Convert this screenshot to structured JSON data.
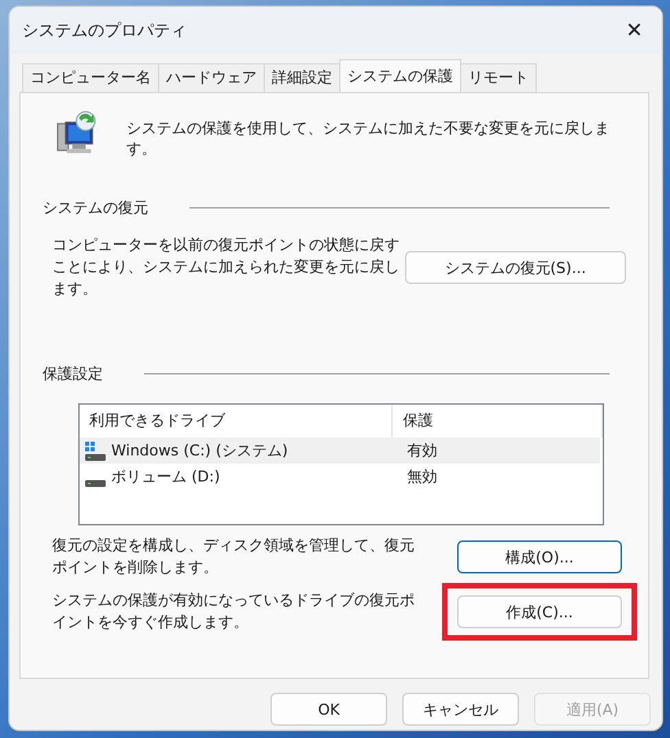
{
  "window": {
    "title": "システムのプロパティ",
    "close": "✕"
  },
  "tabs": [
    {
      "label": "コンピューター名",
      "selected": false
    },
    {
      "label": "ハードウェア",
      "selected": false
    },
    {
      "label": "詳細設定",
      "selected": false
    },
    {
      "label": "システムの保護",
      "selected": true
    },
    {
      "label": "リモート",
      "selected": false
    }
  ],
  "intro": "システムの保護を使用して、システムに加えた不要な変更を元に戻します。",
  "restore_group": {
    "title": "システムの復元",
    "description": "コンピューターを以前の復元ポイントの状態に戻すことにより、システムに加えられた変更を元に戻します。",
    "button": "システムの復元(S)..."
  },
  "protection_group": {
    "title": "保護設定",
    "columns": [
      "利用できるドライブ",
      "保護"
    ],
    "drives": [
      {
        "name": "Windows (C:) (システム)",
        "protection": "有効",
        "kind": "system",
        "selected": true
      },
      {
        "name": "ボリューム (D:)",
        "protection": "無効",
        "kind": "data",
        "selected": false
      }
    ],
    "actions": [
      {
        "description": "復元の設定を構成し、ディスク領域を管理して、復元ポイントを削除します。",
        "button": "構成(O)...",
        "focused": true,
        "highlighted": false
      },
      {
        "description": "システムの保護が有効になっているドライブの復元ポイントを今すぐ作成します。",
        "button": "作成(C)...",
        "focused": false,
        "highlighted": true
      }
    ]
  },
  "buttons": [
    {
      "label": "OK",
      "disabled": false
    },
    {
      "label": "キャンセル",
      "disabled": false
    },
    {
      "label": "適用(A)",
      "disabled": true
    }
  ]
}
